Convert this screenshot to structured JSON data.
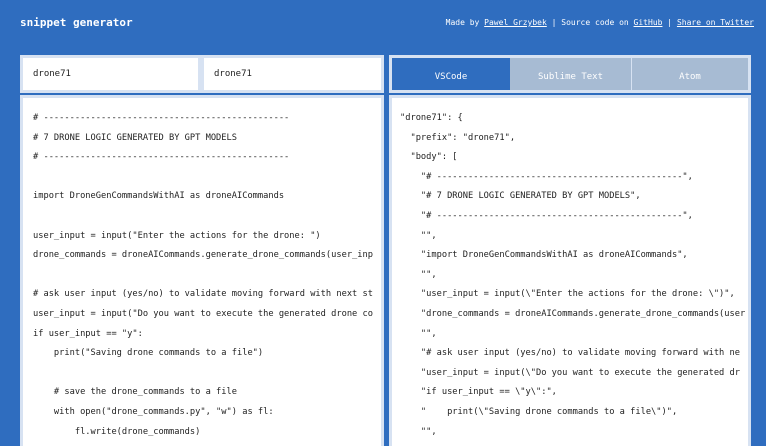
{
  "header": {
    "brand": "snippet generator",
    "made_by_prefix": "Made by",
    "author": "Pawel Grzybek",
    "sep1": "|",
    "source_prefix": "Source code on",
    "github": "GitHub",
    "sep2": "|",
    "share": "Share on Twitter"
  },
  "inputs": {
    "description": "drone71",
    "tab_trigger": "drone71"
  },
  "left_code": "# -----------------------------------------------\n# 7 DRONE LOGIC GENERATED BY GPT MODELS\n# -----------------------------------------------\n\nimport DroneGenCommandsWithAI as droneAICommands\n\nuser_input = input(\"Enter the actions for the drone: \")\ndrone_commands = droneAICommands.generate_drone_commands(user_inp\n\n# ask user input (yes/no) to validate moving forward with next st\nuser_input = input(\"Do you want to execute the generated drone co\nif user_input == \"y\":\n    print(\"Saving drone commands to a file\")\n\n    # save the drone_commands to a file\n    with open(\"drone_commands.py\", \"w\") as fl:\n        fl.write(drone_commands)",
  "tabs": [
    {
      "label": "VSCode",
      "active": true
    },
    {
      "label": "Sublime Text",
      "active": false
    },
    {
      "label": "Atom",
      "active": false
    }
  ],
  "right_code": "\"drone71\": {\n  \"prefix\": \"drone71\",\n  \"body\": [\n    \"# -----------------------------------------------\",\n    \"# 7 DRONE LOGIC GENERATED BY GPT MODELS\",\n    \"# -----------------------------------------------\",\n    \"\",\n    \"import DroneGenCommandsWithAI as droneAICommands\",\n    \"\",\n    \"user_input = input(\\\"Enter the actions for the drone: \\\")\",\n    \"drone_commands = droneAICommands.generate_drone_commands(user\n    \"\",\n    \"# ask user input (yes/no) to validate moving forward with ne\n    \"user_input = input(\\\"Do you want to execute the generated dr\n    \"if user_input == \\\"y\\\":\",\n    \"    print(\\\"Saving drone commands to a file\\\")\",\n    \"\","
}
